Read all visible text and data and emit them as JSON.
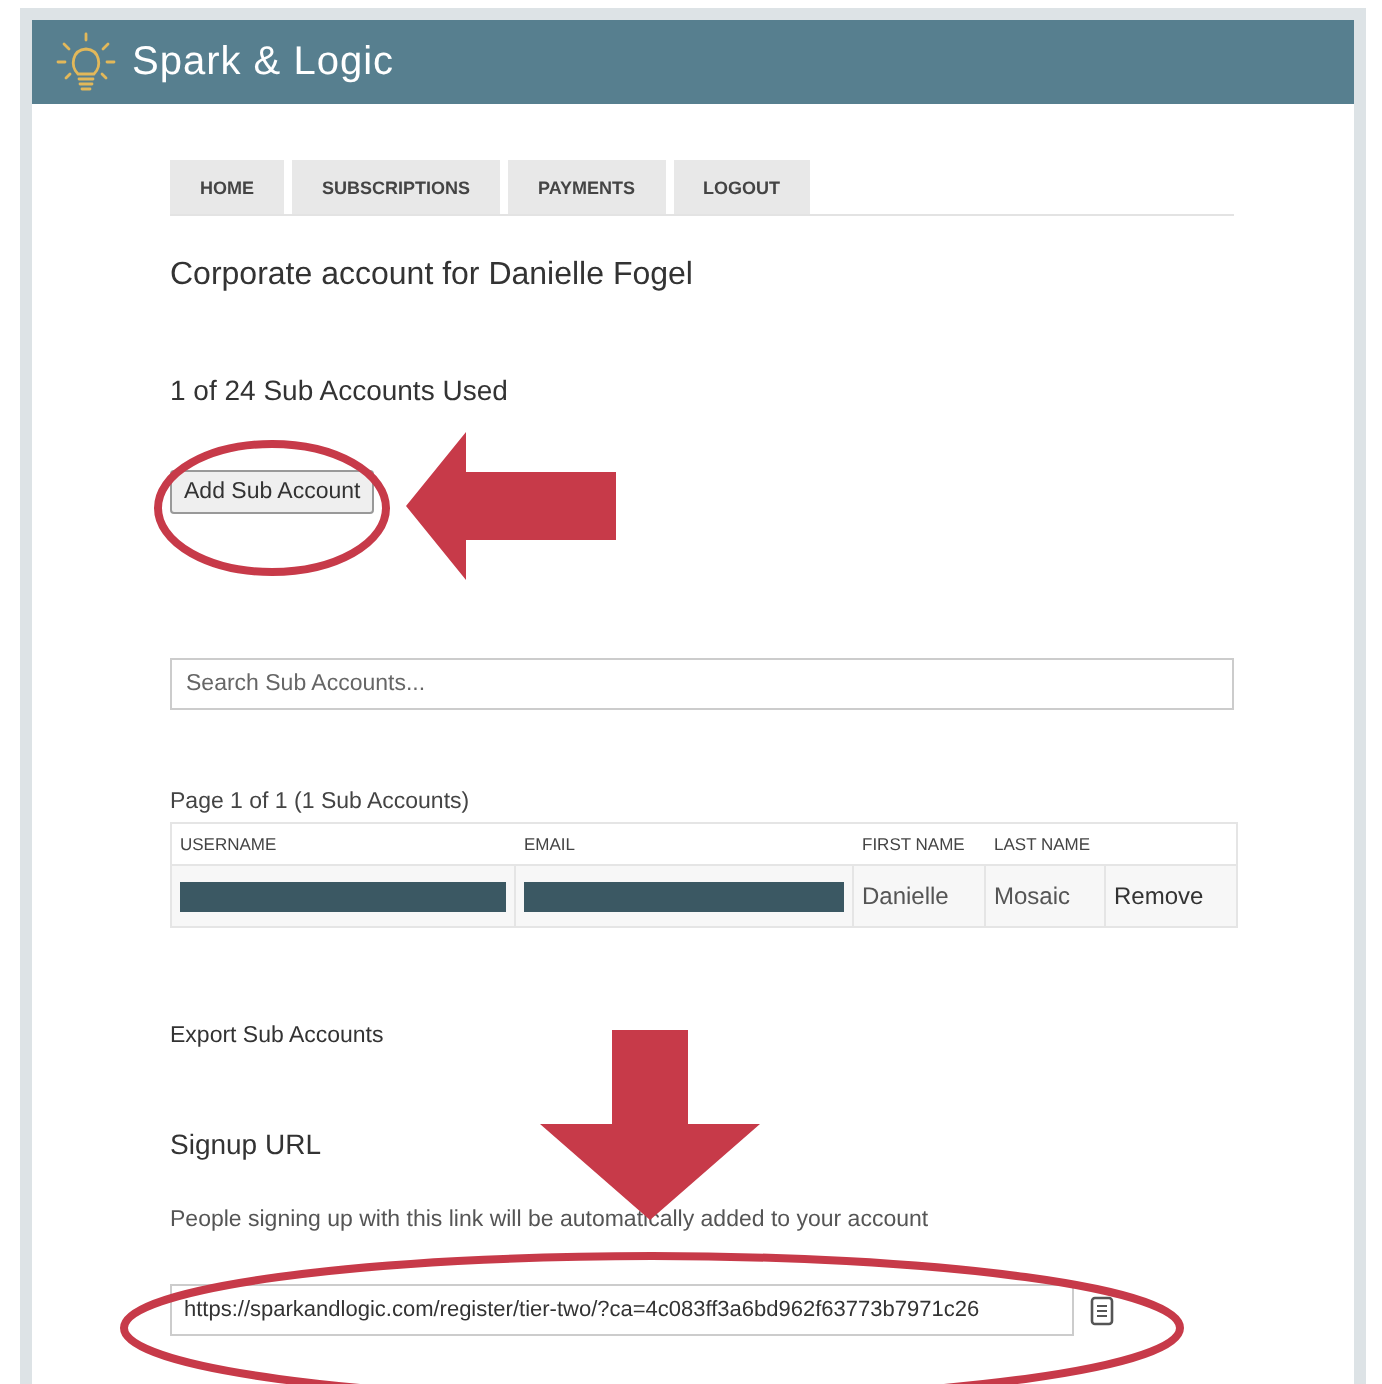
{
  "header": {
    "brand": "Spark & Logic"
  },
  "tabs": [
    {
      "label": "HOME",
      "selected": false
    },
    {
      "label": "SUBSCRIPTIONS",
      "selected": false
    },
    {
      "label": "PAYMENTS",
      "selected": false
    },
    {
      "label": "LOGOUT",
      "selected": false
    }
  ],
  "account_title": "Corporate account for Danielle Fogel",
  "usage": "1 of 24 Sub Accounts Used",
  "add_button": "Add Sub Account",
  "search": {
    "placeholder": "Search Sub Accounts..."
  },
  "pagination": "Page 1 of 1 (1 Sub Accounts)",
  "table": {
    "columns": [
      "USERNAME",
      "EMAIL",
      "FIRST NAME",
      "LAST NAME"
    ],
    "rows": [
      {
        "username_redacted": true,
        "email_redacted": true,
        "first_name": "Danielle",
        "last_name": "Mosaic",
        "action": "Remove"
      }
    ]
  },
  "export_link": "Export Sub Accounts",
  "signup": {
    "heading": "Signup URL",
    "description": "People signing up with this link will be automatically added to your account",
    "url": "https://sparkandlogic.com/register/tier-two/?ca=4c083ff3a6bd962f63773b7971c26"
  }
}
